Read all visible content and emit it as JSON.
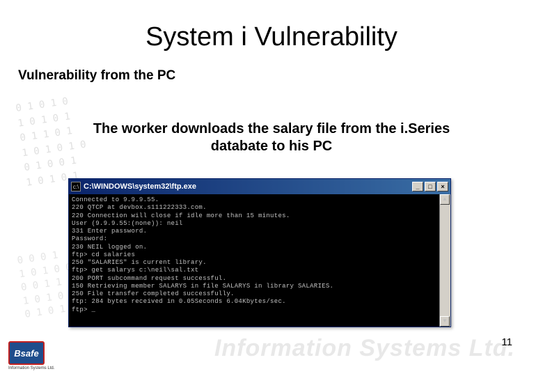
{
  "slide": {
    "title": "System i Vulnerability",
    "subtitle": "Vulnerability from the PC",
    "body_line1": "The worker downloads the salary file from the i.Series",
    "body_line2": "databate to his PC",
    "page_number": "11"
  },
  "ftp_window": {
    "title": "C:\\WINDOWS\\system32\\ftp.exe",
    "minimize": "_",
    "maximize": "□",
    "close": "×",
    "lines": [
      "Connected to 9.9.9.55.",
      "220 QTCP at devbox.s111222333.com.",
      "220 Connection will close if idle more than 15 minutes.",
      "User (9.9.9.55:(none)): neil",
      "331 Enter password.",
      "Password:",
      "230 NEIL logged on.",
      "ftp> cd salaries",
      "250 \"SALARIES\" is current library.",
      "ftp> get salarys c:\\neil\\sal.txt",
      "200 PORT subcommand request successful.",
      "150 Retrieving member SALARYS in file SALARYS in library SALARIES.",
      "250 File transfer completed successfully.",
      "ftp: 284 bytes received in 0.05Seconds 6.04Kbytes/sec.",
      "ftp> _"
    ]
  },
  "logo": {
    "badge_text": "Bsafe",
    "subtext": "Information Systems Ltd."
  },
  "watermark": "Information Systems Ltd."
}
